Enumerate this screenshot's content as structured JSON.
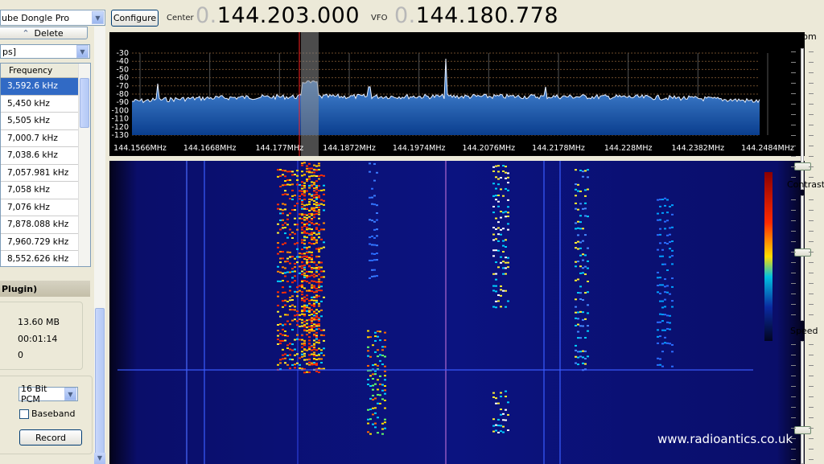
{
  "toolbar": {
    "device": "ube Dongle Pro",
    "configure_label": "Configure",
    "center_label": "Center",
    "center_lead": "0.",
    "center_value": "144.203.000",
    "vfo_label": "VFO",
    "vfo_lead": "0.",
    "vfo_value": "144.180.778"
  },
  "left_panel": {
    "delete_label": "Delete",
    "filter_value": "ps]",
    "table_header": "Frequency",
    "frequencies": [
      "3,592.6 kHz",
      "5,450 kHz",
      "5,505 kHz",
      "7,000.7 kHz",
      "7,038.6 kHz",
      "7,057.981 kHz",
      "7,058 kHz",
      "7,076 kHz",
      "7,878.088 kHz",
      "7,960.729 kHz",
      "8,552.626 kHz"
    ],
    "plugin_label": "Plugin)",
    "file_size": "13.60 MB",
    "duration": "00:01:14",
    "dropped": "0",
    "format_value": "16 Bit PCM",
    "baseband_label": "Baseband",
    "record_label": "Record"
  },
  "spectrum": {
    "db_labels": [
      "-30",
      "-40",
      "-50",
      "-60",
      "-70",
      "-80",
      "-90",
      "-100",
      "-110",
      "-120",
      "-130"
    ],
    "freq_labels": [
      "144.1566MHz",
      "144.1668MHz",
      "144.177MHz",
      "144.1872MHz",
      "144.1974MHz",
      "144.2076MHz",
      "144.2178MHz",
      "144.228MHz",
      "144.2382MHz",
      "144.2484MHz"
    ]
  },
  "right_panel": {
    "zoom_label": "Zoom",
    "contrast_label": "Contrast",
    "speed_label": "Speed"
  },
  "watermark": "www.radioantics.co.uk",
  "colors": {
    "selection": "#316ac5",
    "spectrum_fill": "#1e6fd0",
    "vfo_marker": "#ff2020"
  }
}
